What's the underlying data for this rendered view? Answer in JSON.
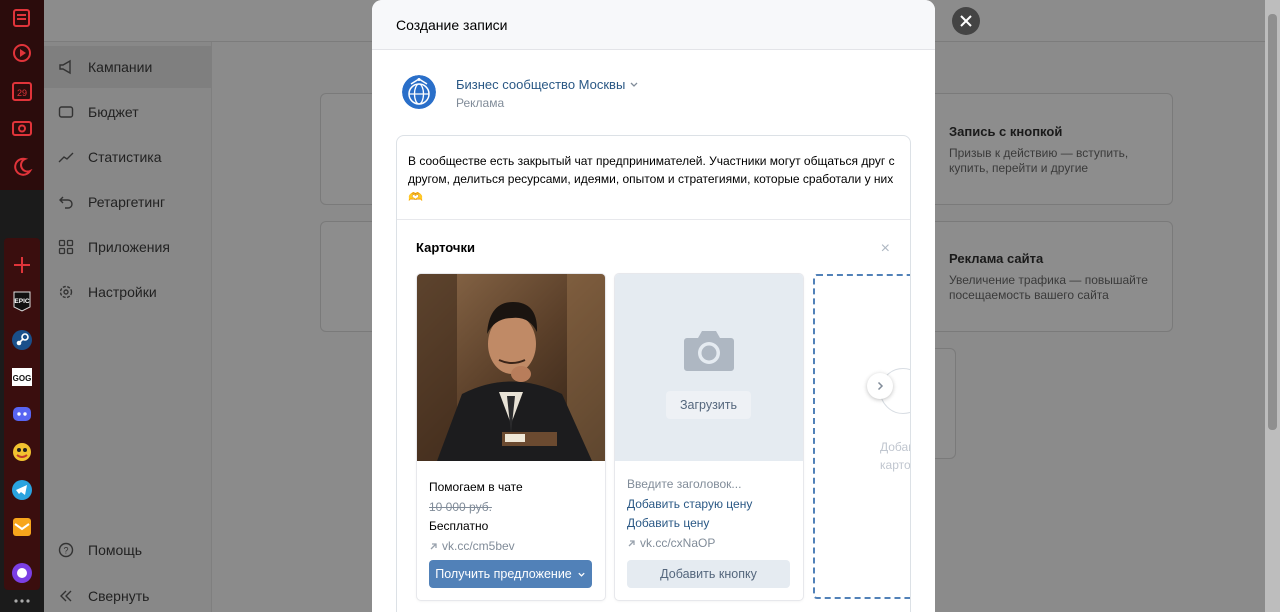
{
  "colors": {
    "accent": "#5181b8",
    "link": "#2a5885",
    "muted": "#818c99"
  },
  "dock": {
    "icons": [
      "notes-icon",
      "play-icon",
      "calendar-icon",
      "cast-icon",
      "moon-icon",
      "plus-icon",
      "epic-games-icon",
      "steam-icon",
      "gog-icon",
      "discord-icon",
      "game-icon",
      "telegram-icon",
      "mail-icon",
      "alice-icon",
      "more-icon"
    ],
    "calendar_day": "29",
    "epic_label": "EPIC",
    "gog_label": "GOG"
  },
  "sidebar": {
    "items": [
      {
        "label": "Кампании",
        "icon": "megaphone-icon"
      },
      {
        "label": "Бюджет",
        "icon": "wallet-icon"
      },
      {
        "label": "Статистика",
        "icon": "chart-icon"
      },
      {
        "label": "Ретаргетинг",
        "icon": "retarget-icon"
      },
      {
        "label": "Приложения",
        "icon": "apps-icon"
      },
      {
        "label": "Настройки",
        "icon": "gear-icon"
      }
    ],
    "help": "Помощь",
    "collapse": "Свернуть"
  },
  "background_cards": [
    {
      "title": "Запись с кнопкой",
      "text": "Призыв к действию — вступить, купить, перейти и другие"
    },
    {
      "title": "Реклама сайта",
      "text": "Увеличение трафика — повышайте посещаемость вашего сайта"
    }
  ],
  "modal": {
    "title": "Создание записи",
    "author_name": "Бизнес сообщество Москвы",
    "author_sub": "Реклама",
    "post_text": "В сообществе есть закрытый чат предпринимателей. Участники могут общаться друг с другом, делиться ресурсами, идеями, опытом и стратегиями, которые сработали у них 🫶",
    "cards_title": "Карточки",
    "cards_close": "×",
    "card1": {
      "title": "Помогаем в чате",
      "old_price": "10 000 руб.",
      "price": "Бесплатно",
      "link": "vk.cc/cm5bev",
      "button": "Получить предложение"
    },
    "card2": {
      "upload": "Загрузить",
      "title_placeholder": "Введите заголовок...",
      "add_old_price": "Добавить старую цену",
      "add_price": "Добавить цену",
      "link": "vk.cc/cxNaOP",
      "button": "Добавить кнопку"
    },
    "add_card_label": "Добавить карточку"
  }
}
